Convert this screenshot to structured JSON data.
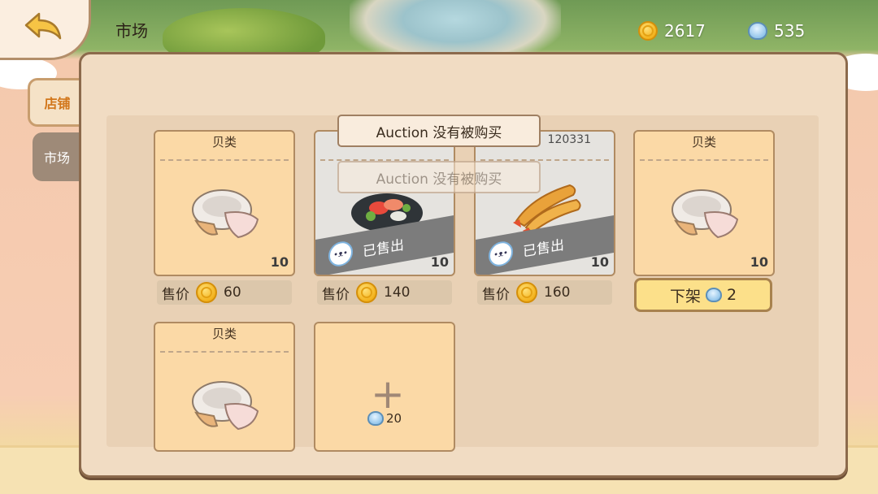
{
  "header": {
    "title": "市场",
    "gold": "2617",
    "bells": "535"
  },
  "tabs": [
    {
      "label": "店铺",
      "active": true
    },
    {
      "label": "市场",
      "active": false
    }
  ],
  "toasts": {
    "primary": "Auction 没有被购买",
    "faded": "Auction 没有被购买"
  },
  "cards": [
    {
      "category": "贝类",
      "item": "shell-icon",
      "qty": "10",
      "price_label": "售价",
      "price": "60"
    },
    {
      "category": "",
      "item": "sashimi-icon",
      "qty": "10",
      "sold_label": "已售出",
      "price_label": "售价",
      "price": "140"
    },
    {
      "category": "",
      "id_text": "120331",
      "item": "fried-shrimp-icon",
      "qty": "10",
      "sold_label": "已售出",
      "price_label": "售价",
      "price": "160"
    },
    {
      "category": "贝类",
      "item": "shell-icon",
      "qty": "10",
      "unlist_label": "下架",
      "unlist_cost": "2"
    },
    {
      "category": "贝类",
      "item": "shell-icon"
    },
    {
      "add_cost": "20"
    }
  ],
  "colors": {
    "panel": "#f1dcc3",
    "card": "#fbd9a6",
    "accent_tab": "#d2761a",
    "button": "#fce08a"
  }
}
